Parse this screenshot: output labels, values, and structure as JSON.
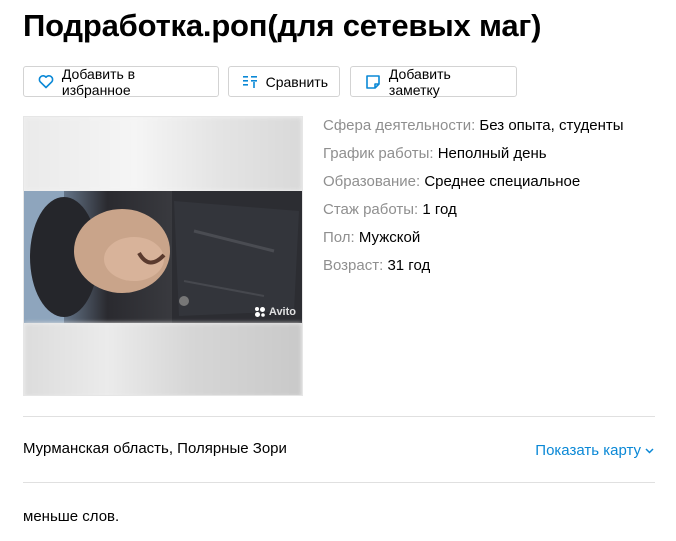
{
  "title": "Подработка.роп(для сетевых маг)",
  "actions": {
    "favorite": "Добавить в избранное",
    "compare": "Сравнить",
    "note": "Добавить заметку"
  },
  "icons": {
    "favorite": "heart-icon",
    "compare": "compare-icon",
    "note": "note-icon",
    "map_chevron": "chevron-down-icon"
  },
  "colors": {
    "accent": "#0a88d6",
    "label": "#8f8f8f",
    "border": "#d3d3d3"
  },
  "photo": {
    "watermark": "Avito"
  },
  "params": [
    {
      "label": "Сфера деятельности:",
      "value": "Без опыта, студенты"
    },
    {
      "label": "График работы:",
      "value": "Неполный день"
    },
    {
      "label": "Образование:",
      "value": "Среднее специальное"
    },
    {
      "label": "Стаж работы:",
      "value": "1 год"
    },
    {
      "label": "Пол:",
      "value": "Мужской"
    },
    {
      "label": "Возраст:",
      "value": "31 год"
    }
  ],
  "location": "Мурманская область, Полярные Зори",
  "map_link": "Показать карту",
  "description": "меньше слов."
}
